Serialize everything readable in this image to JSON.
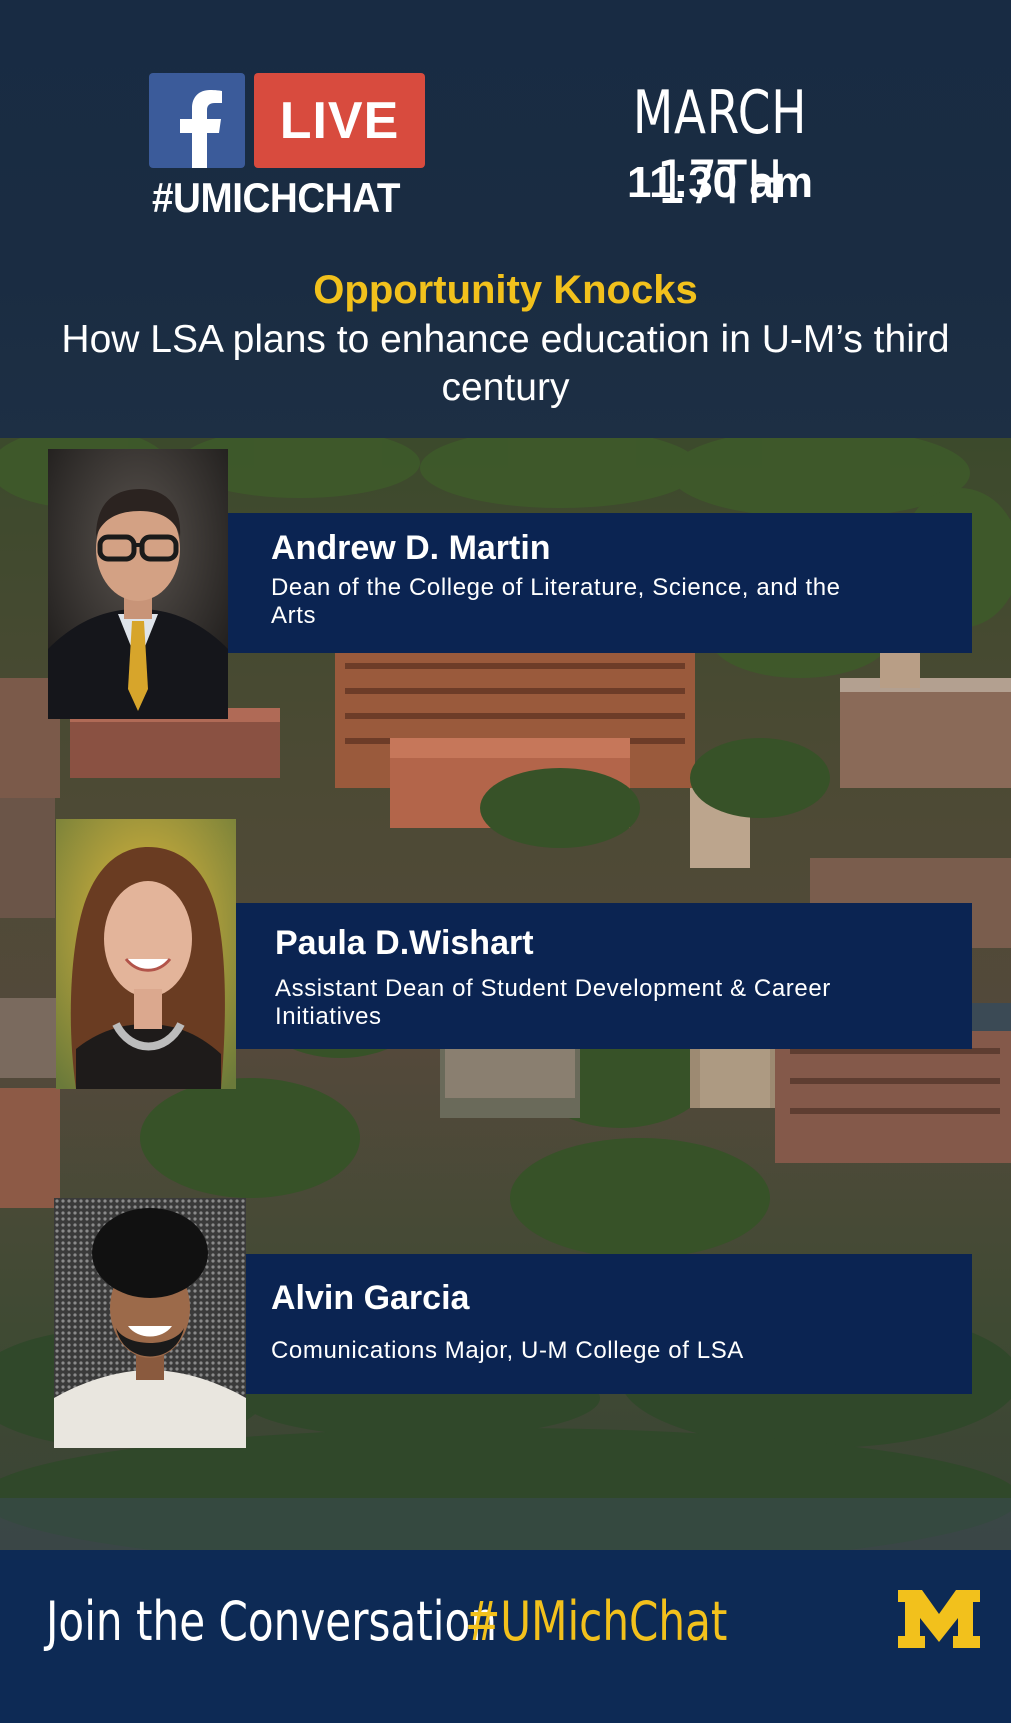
{
  "header": {
    "badge_live": "LIVE",
    "hashtag": "#UMICHCHAT",
    "date": "MARCH 17TH",
    "time": "11:30 am",
    "title": "Opportunity Knocks",
    "subtitle": "How LSA plans to enhance education in U-M’s third century"
  },
  "speakers": [
    {
      "name": "Andrew D. Martin",
      "role": "Dean of the College of Literature, Science, and the Arts"
    },
    {
      "name": "Paula D.Wishart",
      "role": "Assistant Dean of Student Development & Career Initiatives"
    },
    {
      "name": "Alvin Garcia",
      "role": "Comunications Major, U-M College of LSA"
    }
  ],
  "footer": {
    "join_text": "Join the Conversation",
    "hashtag": "#UMichChat"
  },
  "icons": {
    "facebook": "facebook-logo-icon",
    "block_m": "umich-block-m-logo"
  },
  "colors": {
    "header_bg": "#182b43",
    "card_bg": "#0b2452",
    "footer_bg": "#0d2a55",
    "maize": "#f2c11c",
    "facebook_blue": "#3b5b9a",
    "live_red": "#d84b3e"
  }
}
